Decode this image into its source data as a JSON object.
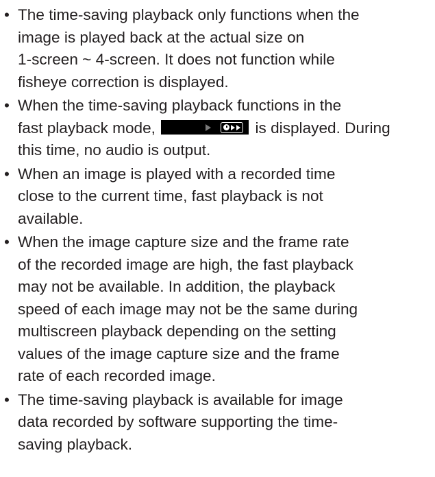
{
  "bullet_glyph": "•",
  "notes": [
    {
      "lines": [
        "The time-saving playback only functions when the",
        "image is played back at the actual size on",
        "1-screen ~ 4-screen. It does not function while",
        "fisheye correction is displayed."
      ]
    },
    {
      "lines": [
        "When the time-saving playback functions in the"
      ],
      "line2_before": "fast playback mode,",
      "line2_after": "is displayed. During",
      "line3": "this time, no audio is output.",
      "indicator_icon": "time-saving-fast-playback-indicator-icon"
    },
    {
      "lines": [
        "When an image is played with a recorded time",
        "close to the current time, fast playback is not",
        "available."
      ]
    },
    {
      "lines": [
        "When the image capture size and the frame rate",
        "of the recorded image are high, the fast playback",
        "may not be available. In addition, the playback",
        "speed of each image may not be the same during",
        "multiscreen playback depending on the setting",
        "values of the image capture size and the frame",
        "rate of each recorded image."
      ]
    },
    {
      "lines": [
        "The time-saving playback is available for image",
        "data recorded by software supporting the time-",
        "saving playback."
      ]
    }
  ]
}
